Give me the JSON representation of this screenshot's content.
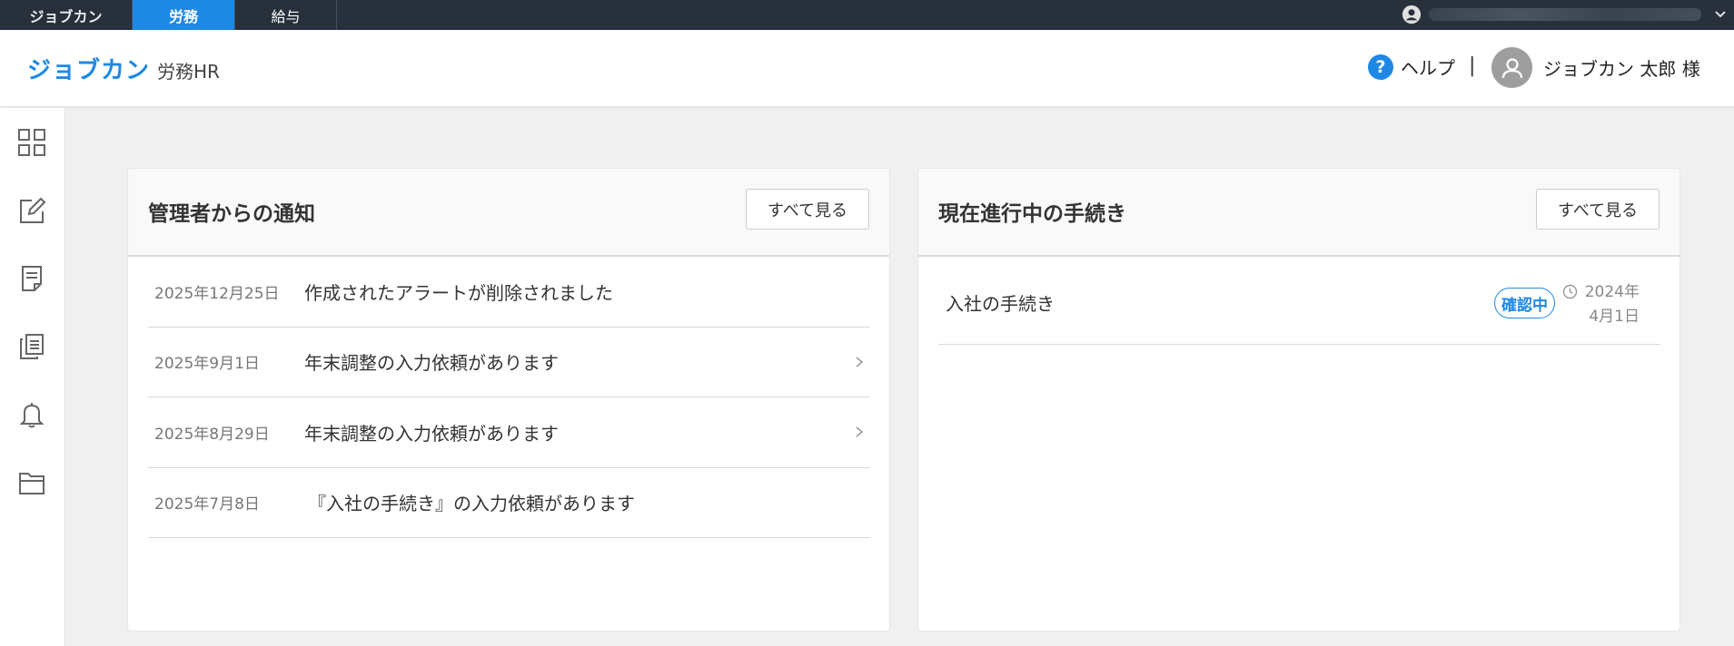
{
  "topbar": {
    "brand": "ジョブカン",
    "tabs": [
      {
        "label": "労務",
        "active": true
      },
      {
        "label": "給与",
        "active": false
      }
    ]
  },
  "header": {
    "logo_main": "ジョブカン",
    "logo_sub": "労務HR",
    "help_label": "ヘルプ",
    "separator": "|",
    "user_name": "ジョブカン 太郎 様"
  },
  "sidebar": {
    "items": [
      {
        "icon": "dashboard-icon"
      },
      {
        "icon": "edit-icon"
      },
      {
        "icon": "document-icon"
      },
      {
        "icon": "documents-icon"
      },
      {
        "icon": "bell-icon"
      },
      {
        "icon": "folder-icon"
      }
    ]
  },
  "notices": {
    "title": "管理者からの通知",
    "view_all": "すべて見る",
    "items": [
      {
        "date": "2025年12月25日",
        "text": "作成されたアラートが削除されました",
        "has_link": false
      },
      {
        "date": "2025年9月1日",
        "text": "年末調整の入力依頼があります",
        "has_link": true
      },
      {
        "date": "2025年8月29日",
        "text": "年末調整の入力依頼があります",
        "has_link": true
      },
      {
        "date": "2025年7月8日",
        "text": "『入社の手続き』の入力依頼があります",
        "has_link": false
      }
    ]
  },
  "procedures": {
    "title": "現在進行中の手続き",
    "view_all": "すべて見る",
    "items": [
      {
        "name": "入社の手続き",
        "status": "確認中",
        "date_line1": "2024年",
        "date_line2": "4月1日"
      }
    ]
  },
  "colors": {
    "accent": "#1e88e5",
    "topbar": "#27303b"
  }
}
